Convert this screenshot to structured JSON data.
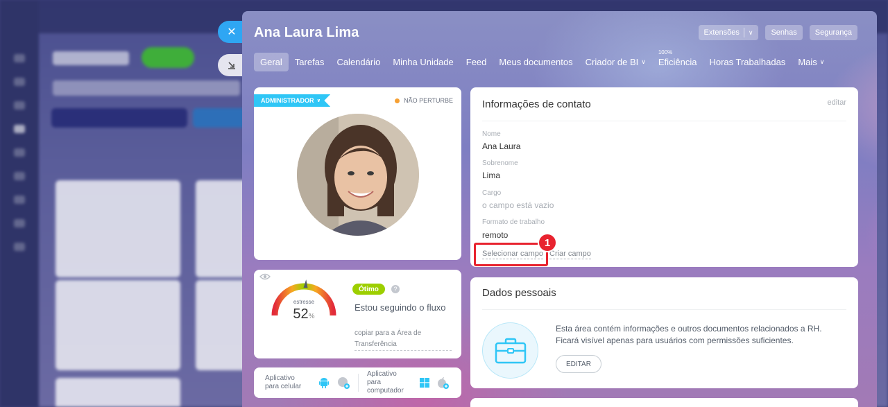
{
  "header": {
    "title": "Ana Laura Lima"
  },
  "top_actions": {
    "extensions": "Extensões",
    "passwords": "Senhas",
    "security": "Segurança"
  },
  "tabs": [
    {
      "label": "Geral"
    },
    {
      "label": "Tarefas"
    },
    {
      "label": "Calendário"
    },
    {
      "label": "Minha Unidade"
    },
    {
      "label": "Feed"
    },
    {
      "label": "Meus documentos"
    },
    {
      "label": "Criador de BI"
    },
    {
      "label": "Eficiência",
      "sup": "100%"
    },
    {
      "label": "Horas Trabalhadas"
    },
    {
      "label": "Mais"
    }
  ],
  "profile": {
    "role_badge": "ADMINISTRADOR",
    "status": "NÃO PERTURBE"
  },
  "stress": {
    "label": "estresse",
    "value": 52,
    "unit": "%",
    "badge": "Ótimo",
    "status_text": "Estou seguindo o fluxo",
    "copy_link": "copiar para a Área de Transferência"
  },
  "apps": {
    "mobile_label": "Aplicativo para celular",
    "desktop_label": "Aplicativo para computador"
  },
  "contact": {
    "heading": "Informações de contato",
    "edit": "editar",
    "fields": [
      {
        "label": "Nome",
        "value": "Ana Laura"
      },
      {
        "label": "Sobrenome",
        "value": "Lima"
      },
      {
        "label": "Cargo",
        "value": "o campo está vazio"
      },
      {
        "label": "Formato de trabalho",
        "value": "remoto"
      }
    ],
    "select_field": "Selecionar campo",
    "create_field": "Criar campo"
  },
  "annotation": {
    "step": "1"
  },
  "personal": {
    "heading": "Dados pessoais",
    "text_line1": "Esta área contém informações e outros documentos relacionados a RH.",
    "text_line2": "Ficará visível apenas para usuários com permissões suficientes.",
    "edit_button": "EDITAR"
  },
  "colors": {
    "accent": "#2fc6f6",
    "ok": "#9dcf00",
    "highlight": "#e8232f",
    "close": "#2fa6f3"
  }
}
